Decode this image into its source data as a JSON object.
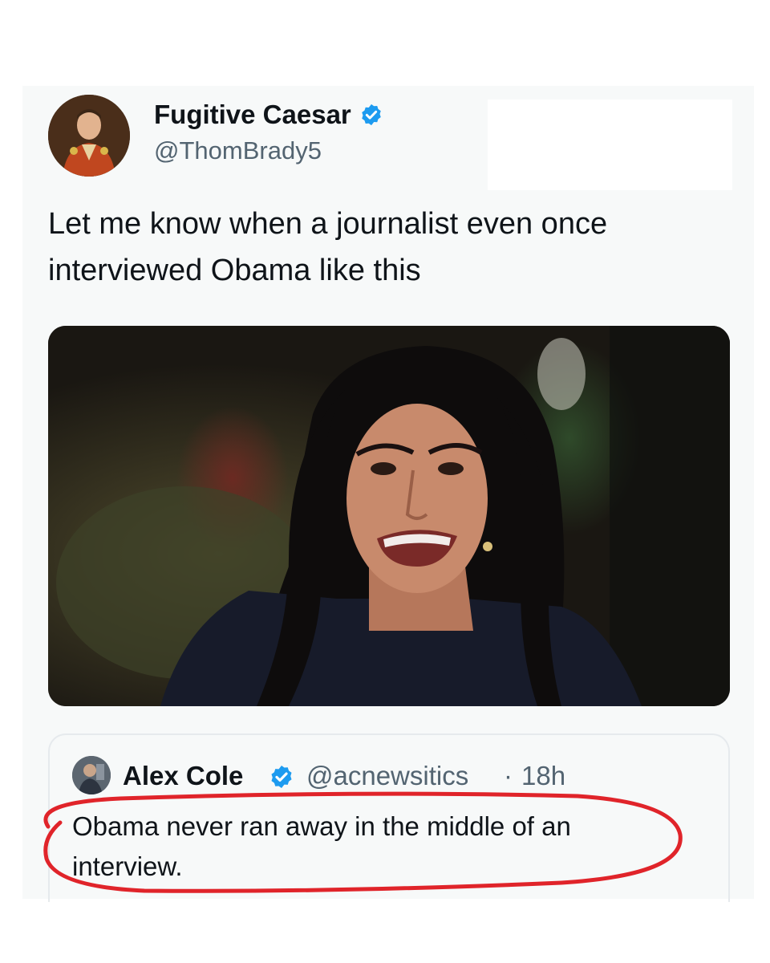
{
  "tweet": {
    "author": {
      "display_name": "Fugitive Caesar",
      "handle": "@ThomBrady5",
      "verified": true,
      "avatar_icon": "profile-avatar"
    },
    "text": "Let me know when a journalist even once interviewed Obama like this",
    "media_icon": "photo-woman-speaking"
  },
  "quoted_tweet": {
    "author": {
      "display_name": "Alex Cole",
      "handle": "@acnewsitics",
      "verified": true
    },
    "separator": "·",
    "timestamp": "18h",
    "text": "Obama never ran away in the middle of an interview."
  },
  "colors": {
    "verified_blue": "#1d9bf0",
    "annotation_red": "#e0242a",
    "text_primary": "#0f1419",
    "text_secondary": "#536471"
  }
}
